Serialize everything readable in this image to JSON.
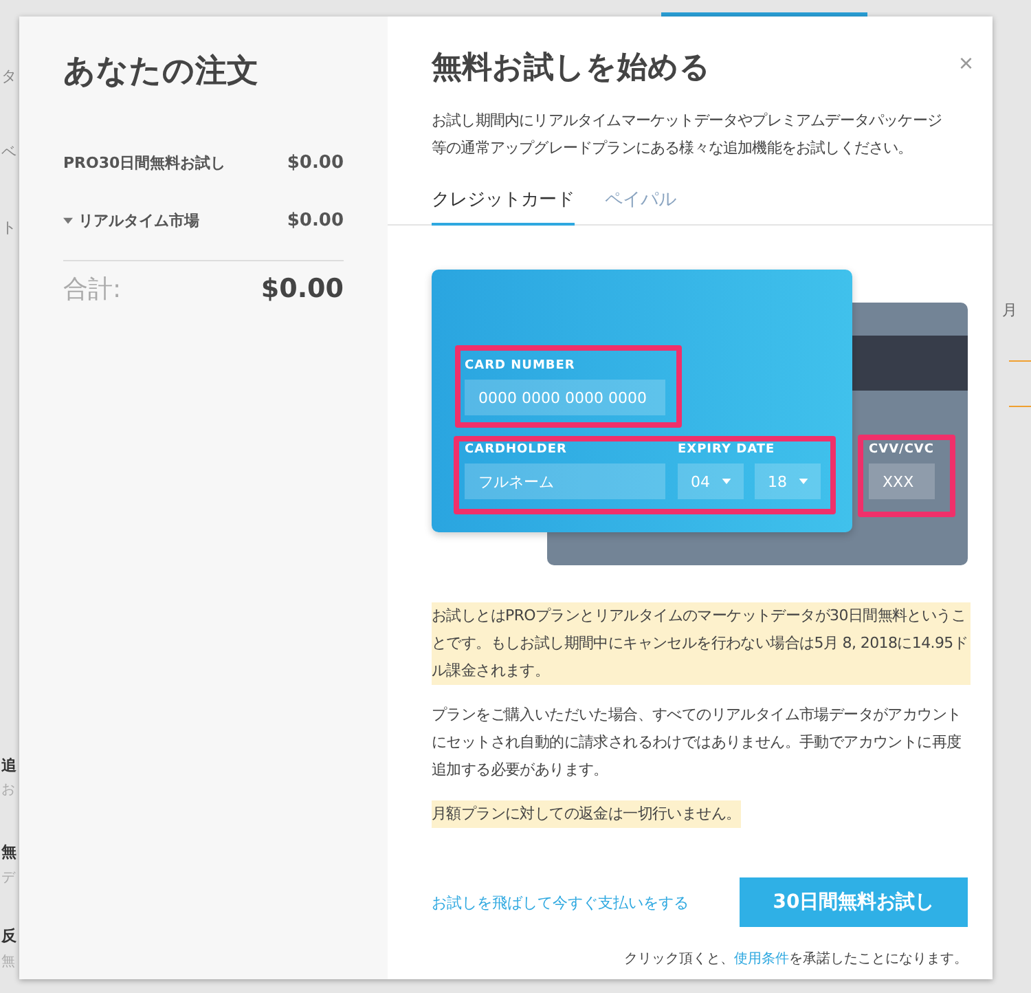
{
  "background": {
    "left_fragments": [
      "タ",
      "ベ",
      "ト",
      "追",
      "お",
      "無",
      "デ",
      "反",
      "無"
    ],
    "right_fragments": [
      "月"
    ]
  },
  "order": {
    "title": "あなたの注文",
    "items": [
      {
        "label": "PRO30日間無料お試し",
        "price": "$0.00",
        "expandable": false
      },
      {
        "label": "リアルタイム市場",
        "price": "$0.00",
        "expandable": true
      }
    ],
    "total_label": "合計:",
    "total": "$0.00"
  },
  "trial": {
    "title": "無料お試しを始める",
    "close": "×",
    "description": "お試し期間内にリアルタイムマーケットデータやプレミアムデータパッケージ等の通常アップグレードプランにある様々な追加機能をお試しください。",
    "tabs": [
      {
        "label": "クレジットカード",
        "selected": true
      },
      {
        "label": "ペイパル",
        "selected": false
      }
    ],
    "card": {
      "number_label": "CARD NUMBER",
      "number_placeholder": "0000 0000 0000 0000",
      "holder_label": "CARDHOLDER",
      "holder_placeholder": "フルネーム",
      "expiry_label": "EXPIRY DATE",
      "month": "04",
      "year": "18",
      "cvv_label": "CVV/CVC",
      "cvv_placeholder": "XXX"
    },
    "notes": [
      {
        "text": "お試しとはPROプランとリアルタイムのマーケットデータが30日間無料ということです。もしお試し期間中にキャンセルを行わない場合は5月 8, 2018に14.95ドル課金されます。",
        "highlighted": true
      },
      {
        "text": "プランをご購入いただいた場合、すべてのリアルタイム市場データがアカウントにセットされ自動的に請求されるわけではありません。手動でアカウントに再度追加する必要があります。",
        "highlighted": false
      },
      {
        "text": "月額プランに対しての返金は一切行いません。",
        "highlighted": true
      }
    ],
    "skip_link": "お試しを飛ばして今すぐ支払いをする",
    "start_button": "30日間無料お試し",
    "terms": {
      "before": "クリック頂くと、",
      "link": "使用条件",
      "after": "を承諾したことになります。"
    }
  }
}
